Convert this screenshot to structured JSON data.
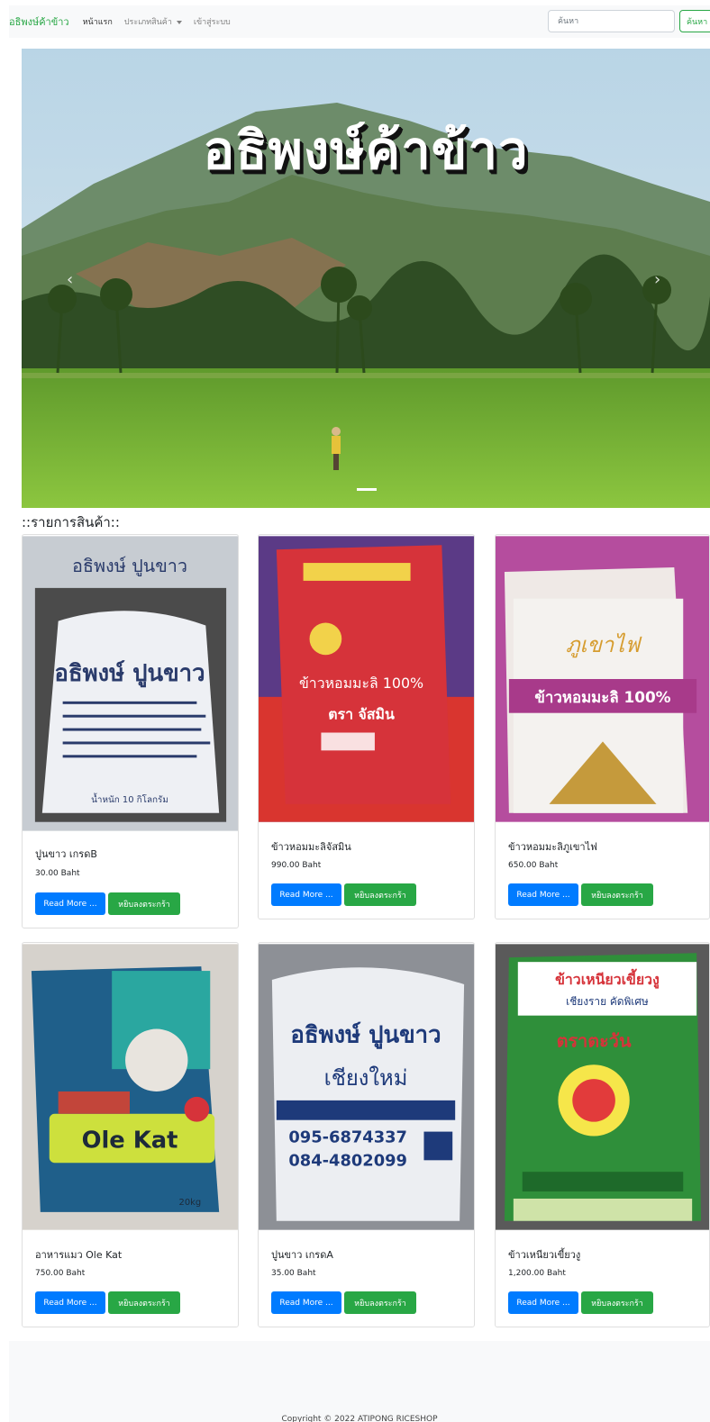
{
  "navbar": {
    "brand": "อธิพงษ์ค้าข้าว",
    "links": [
      "หน้าแรก",
      "ประเภทสินค้า",
      "เข้าสู่ระบบ"
    ],
    "search_placeholder": "ค้นหา",
    "search_button": "ค้นหา"
  },
  "carousel": {
    "title": "อธิพงษ์ค้าข้าว",
    "prev": "‹",
    "next": "›"
  },
  "section_title": "::รายการสินค้า::",
  "products": [
    {
      "name": "ปูนขาว เกรดB",
      "price": "30.00 Baht"
    },
    {
      "name": "ข้าวหอมมะลิจัสมิน",
      "price": "990.00 Baht"
    },
    {
      "name": "ข้าวหอมมะลิภูเขาไฟ",
      "price": "650.00 Baht"
    },
    {
      "name": "อาหารแมว Ole Kat",
      "price": "750.00 Baht"
    },
    {
      "name": "ปูนขาว เกรดA",
      "price": "35.00 Baht"
    },
    {
      "name": "ข้าวเหนียวเขี้ยวงู",
      "price": "1,200.00 Baht"
    }
  ],
  "buttons": {
    "read_more": "Read More ...",
    "add_to_cart": "หยิบลงตระกร้า"
  },
  "product_images": [
    {
      "heading": "อธิพงษ์ ปูนขาว",
      "label": "อธิพงษ์ ปูนขาว",
      "weight": "น้ำหนัก 10 กิโลกรัม"
    },
    {
      "label": "ข้าวหอมมะลิ 100%",
      "brand": "ตรา จัสมิน"
    },
    {
      "label": "ข้าวหอมมะลิ 100%",
      "brand": "ภูเขาไฟ"
    },
    {
      "label": "Ole Kat",
      "weight": "20kg"
    },
    {
      "label": "อธิพงษ์ ปูนขาว",
      "city": "เชียงใหม่",
      "phone1": "095-6874337",
      "phone2": "084-4802099"
    },
    {
      "label": "ข้าวเหนียวเขี้ยวงู",
      "sub": "เชียงราย คัดพิเศษ",
      "brand": "ตราตะวัน"
    }
  ],
  "footer": {
    "copyright": "Copyright © 2022 ATIPONG RICESHOP"
  }
}
